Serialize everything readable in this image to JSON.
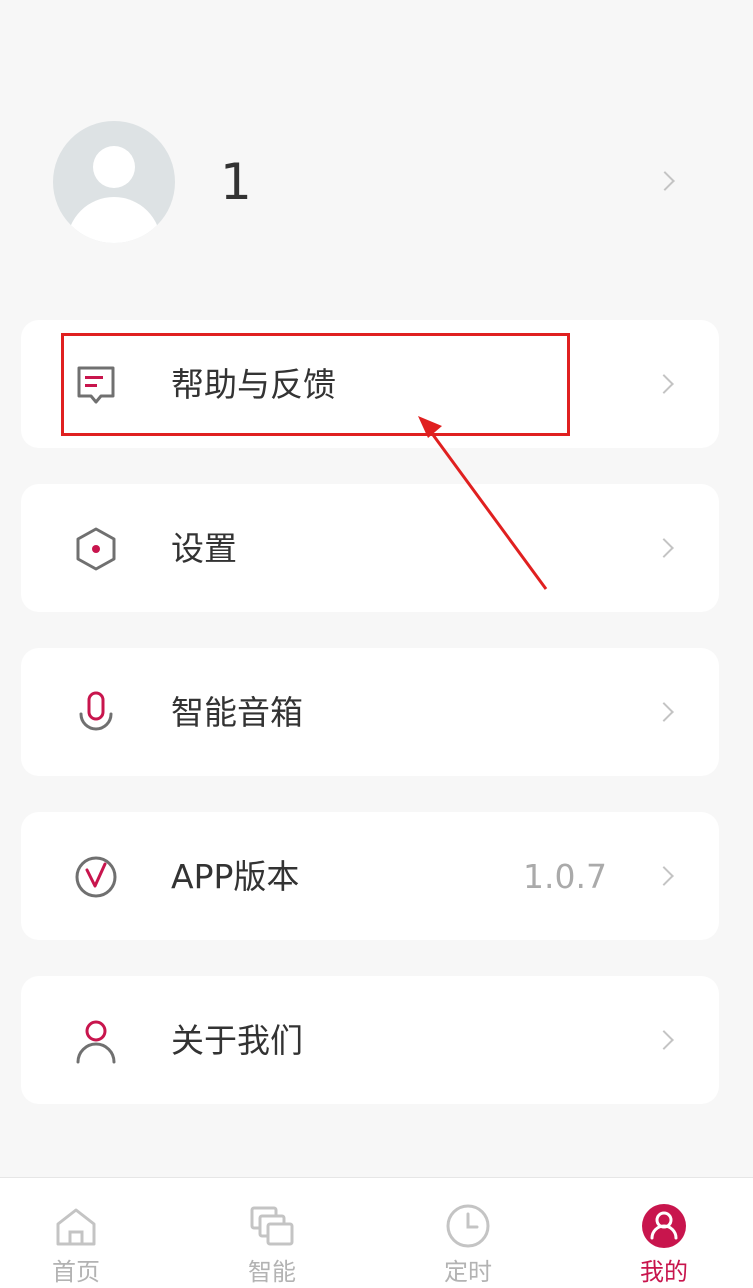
{
  "profile": {
    "username": "1"
  },
  "menu": [
    {
      "label": "帮助与反馈",
      "icon": "feedback-icon"
    },
    {
      "label": "设置",
      "icon": "settings-hexagon-icon"
    },
    {
      "label": "智能音箱",
      "icon": "microphone-icon"
    },
    {
      "label": "APP版本",
      "icon": "version-v-icon",
      "value": "1.0.7"
    },
    {
      "label": "关于我们",
      "icon": "user-icon"
    }
  ],
  "tabs": [
    {
      "label": "首页",
      "icon": "home-icon"
    },
    {
      "label": "智能",
      "icon": "devices-icon"
    },
    {
      "label": "定时",
      "icon": "clock-icon"
    },
    {
      "label": "我的",
      "icon": "user-circle-icon",
      "active": true
    }
  ],
  "colors": {
    "accent": "#c8154d",
    "annotation": "#e02020",
    "muted": "#b3b3b3"
  }
}
